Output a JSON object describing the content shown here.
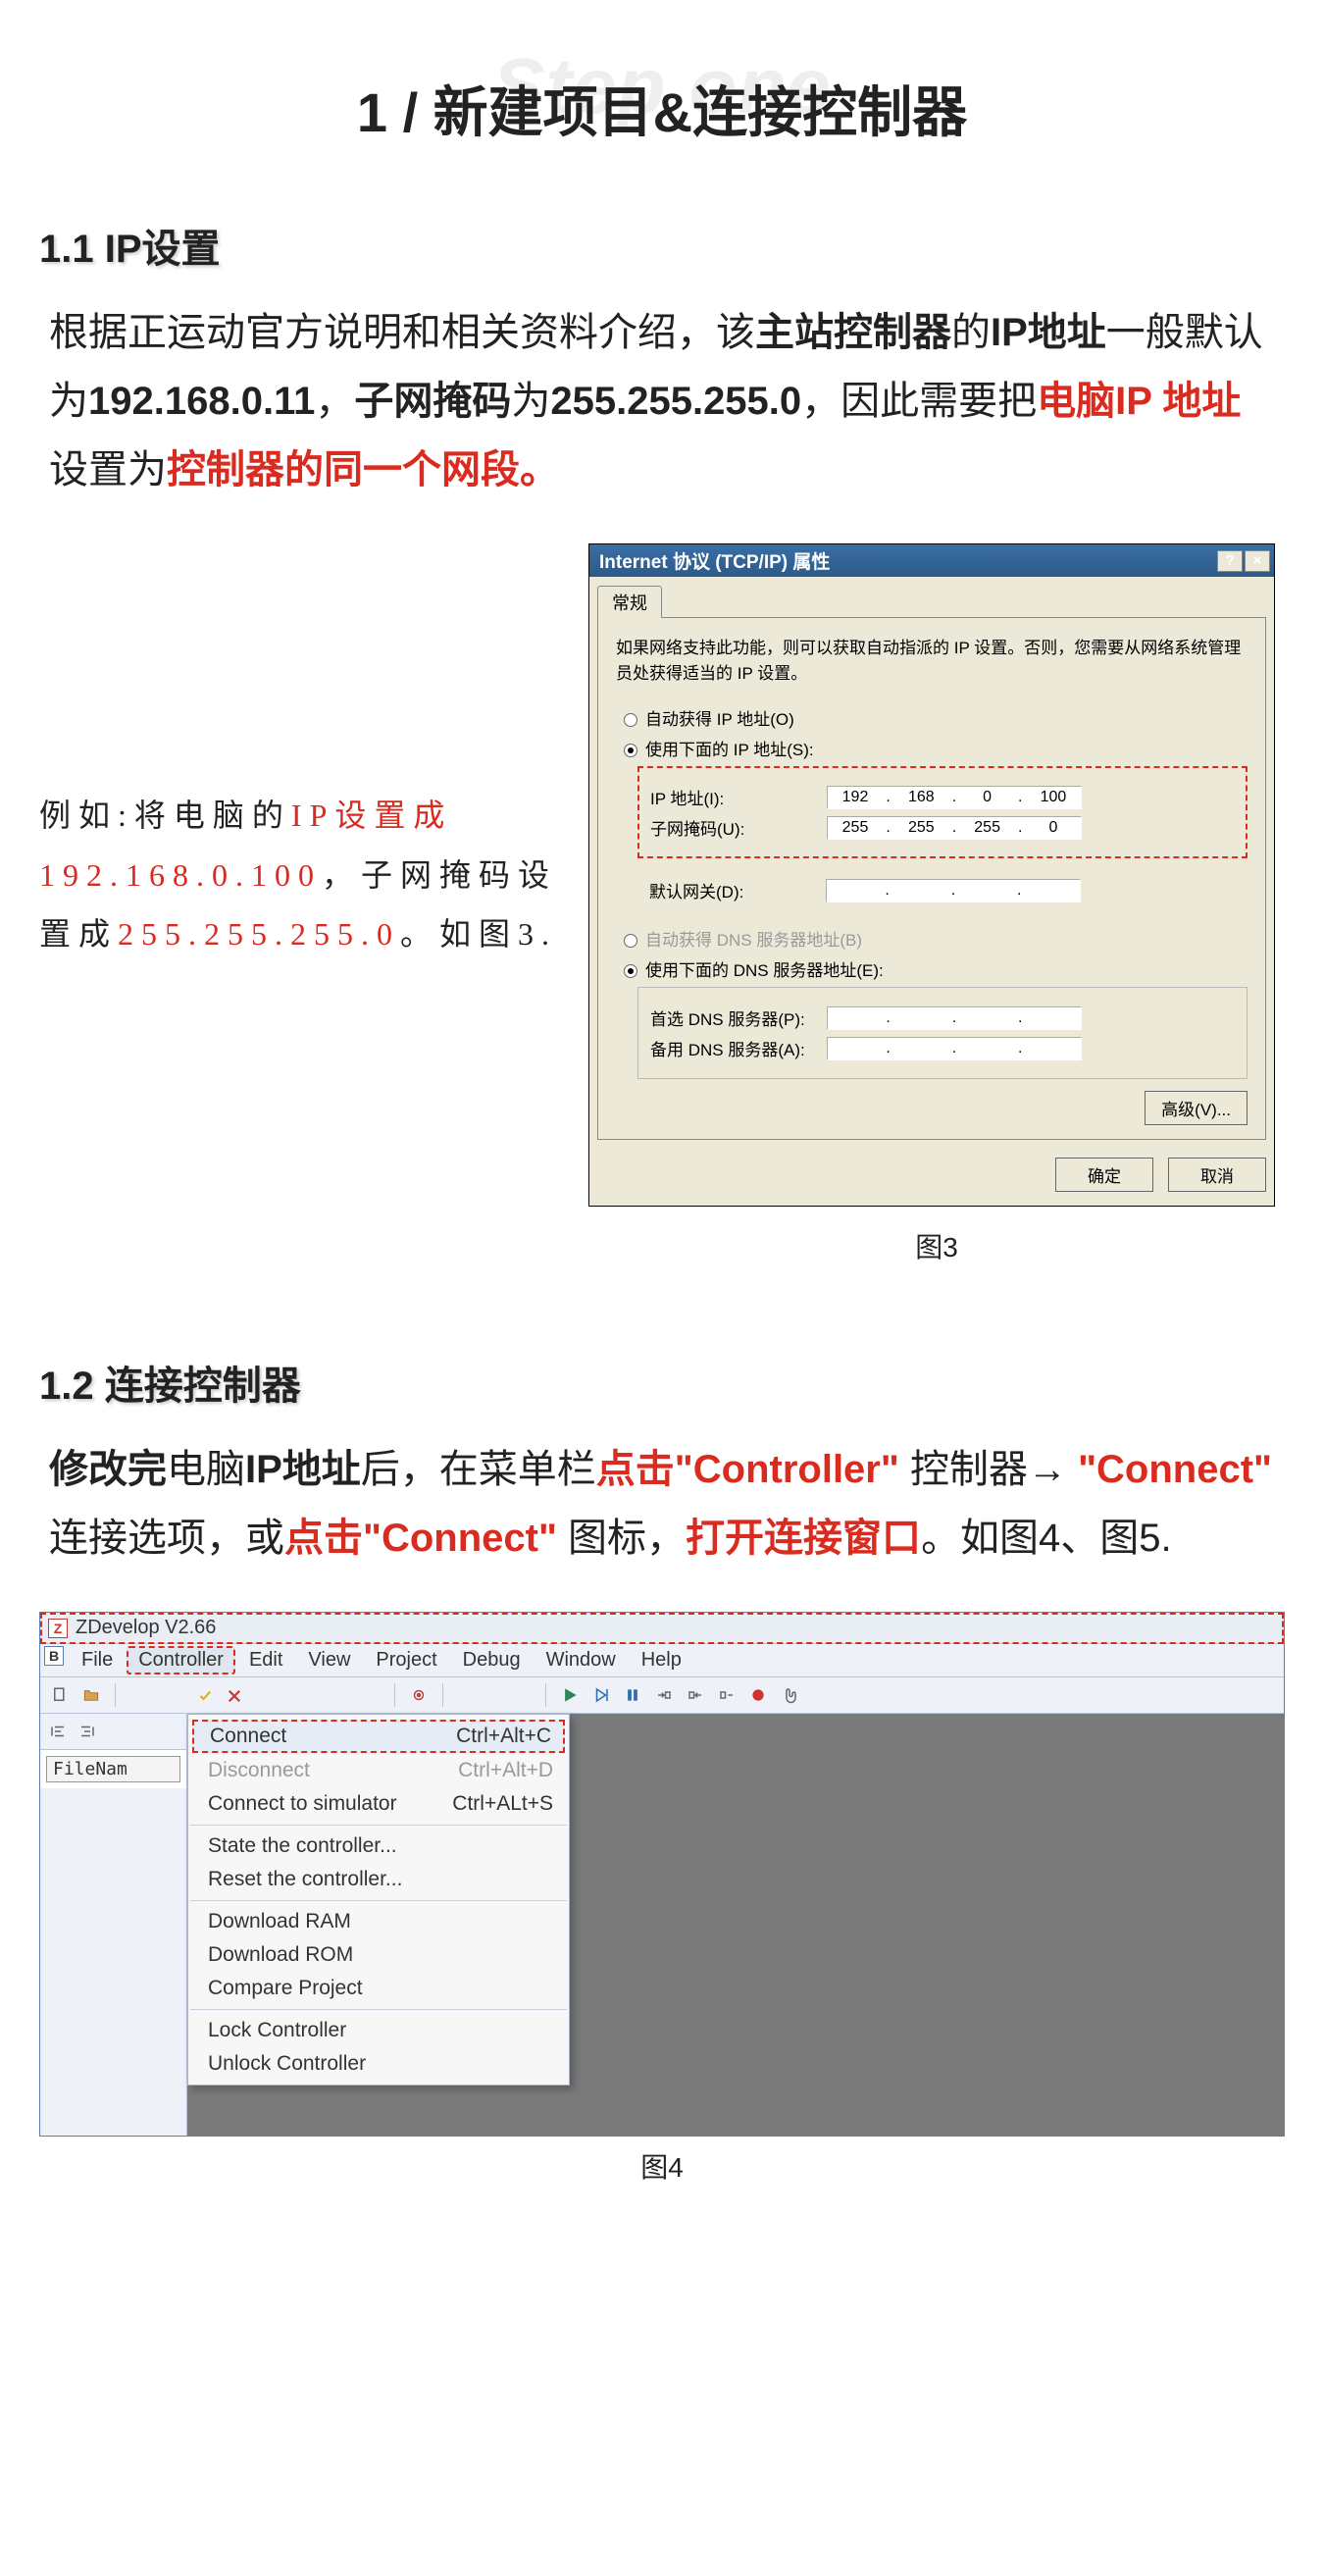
{
  "header": {
    "ghost": "Step one",
    "title": "1 / 新建项目&连接控制器"
  },
  "s11": {
    "heading": "1.1  IP设置",
    "para_pre": "根据正运动官方说明和相关资料介绍，该",
    "t_main_ctrl": "主站控制器",
    "t_of": "的",
    "t_ip_addr": "IP地址",
    "t_default": "一般默认为",
    "t_ip": "192.168.0.11",
    "t_comma": "，",
    "t_subnet_l": "子网掩码",
    "t_is": "为",
    "t_mask": "255.255.255.0",
    "t_comma2": "，因此需要把",
    "t_pcip": "电脑IP 地址",
    "t_setto": "设置为",
    "t_same": "控制器的同一个网段。",
    "side_1": "例如:将电脑的",
    "side_2": "IP设置成192.168.0.100",
    "side_3": "，子网掩码设置成",
    "side_4": "255.255.255.0",
    "side_5": "。如图3.",
    "fig_caption": "图3"
  },
  "dlg": {
    "title": "Internet 协议 (TCP/IP) 属性",
    "tab": "常规",
    "desc": "如果网络支持此功能，则可以获取自动指派的 IP 设置。否则，您需要从网络系统管理员处获得适当的 IP 设置。",
    "r_auto_ip": "自动获得 IP 地址(O)",
    "r_use_ip": "使用下面的 IP 地址(S):",
    "f_ip": "IP 地址(I):",
    "f_mask": "子网掩码(U):",
    "f_gw": "默认网关(D):",
    "ip": [
      "192",
      "168",
      "0",
      "100"
    ],
    "mask": [
      "255",
      "255",
      "255",
      "0"
    ],
    "gw": [
      "",
      "",
      "",
      ""
    ],
    "r_auto_dns": "自动获得 DNS 服务器地址(B)",
    "r_use_dns": "使用下面的 DNS 服务器地址(E):",
    "f_dns1": "首选 DNS 服务器(P):",
    "f_dns2": "备用 DNS 服务器(A):",
    "dns1": [
      "",
      "",
      "",
      ""
    ],
    "dns2": [
      "",
      "",
      "",
      ""
    ],
    "btn_adv": "高级(V)...",
    "btn_ok": "确定",
    "btn_cancel": "取消"
  },
  "s12": {
    "heading": "1.2  连接控制器",
    "p_1": "修改完",
    "p_2": "电脑",
    "p_3": "IP地址",
    "p_4": "后，在菜单栏",
    "p_click1": "点击\"Controller\"",
    "p_5": " 控制器→ ",
    "p_connect": "\"Connect\"",
    "p_6": " 连接选项，或",
    "p_click2": "点击\"Connect\"",
    "p_7": " 图标，",
    "p_open": "打开连接窗口",
    "p_8": "。如图4、图5.",
    "fig_caption": "图4"
  },
  "zdev": {
    "app_title": "ZDevelop V2.66",
    "menu": [
      "File",
      "Controller",
      "Edit",
      "View",
      "Project",
      "Debug",
      "Window",
      "Help"
    ],
    "filecol_header": "FileNam",
    "dropdown": [
      {
        "label": "Connect",
        "short": "Ctrl+Alt+C",
        "hl": true
      },
      {
        "label": "Disconnect",
        "short": "Ctrl+Alt+D",
        "dis": true
      },
      {
        "label": "Connect to simulator",
        "short": "Ctrl+ALt+S"
      },
      {
        "sep": true
      },
      {
        "label": "State the controller..."
      },
      {
        "label": "Reset the controller..."
      },
      {
        "sep": true
      },
      {
        "label": "Download RAM"
      },
      {
        "label": "Download ROM"
      },
      {
        "label": "Compare Project"
      },
      {
        "sep": true
      },
      {
        "label": "Lock Controller"
      },
      {
        "label": "Unlock Controller"
      }
    ]
  }
}
